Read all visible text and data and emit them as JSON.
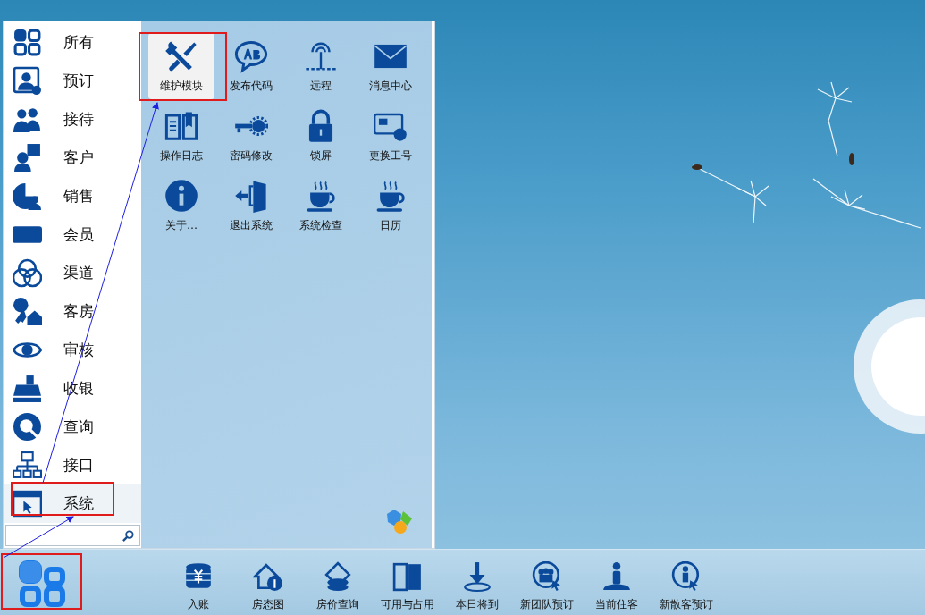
{
  "start_menu": {
    "categories": [
      {
        "label": "所有",
        "selected": false
      },
      {
        "label": "预订",
        "selected": false
      },
      {
        "label": "接待",
        "selected": false
      },
      {
        "label": "客户",
        "selected": false
      },
      {
        "label": "销售",
        "selected": false
      },
      {
        "label": "会员",
        "selected": false
      },
      {
        "label": "渠道",
        "selected": false
      },
      {
        "label": "客房",
        "selected": false
      },
      {
        "label": "审核",
        "selected": false
      },
      {
        "label": "收银",
        "selected": false
      },
      {
        "label": "查询",
        "selected": false
      },
      {
        "label": "接口",
        "selected": false
      },
      {
        "label": "系统",
        "selected": true
      }
    ],
    "apps": [
      {
        "label": "维护模块",
        "selected": true
      },
      {
        "label": "发布代码",
        "selected": false
      },
      {
        "label": "远程",
        "selected": false
      },
      {
        "label": "消息中心",
        "selected": false
      },
      {
        "label": "操作日志",
        "selected": false
      },
      {
        "label": "密码修改",
        "selected": false
      },
      {
        "label": "锁屏",
        "selected": false
      },
      {
        "label": "更换工号",
        "selected": false
      },
      {
        "label": "关于…",
        "selected": false
      },
      {
        "label": "退出系统",
        "selected": false
      },
      {
        "label": "系统检查",
        "selected": false
      },
      {
        "label": "日历",
        "selected": false
      }
    ]
  },
  "taskbar": {
    "items": [
      {
        "label": "入账"
      },
      {
        "label": "房态图"
      },
      {
        "label": "房价查询"
      },
      {
        "label": "可用与占用"
      },
      {
        "label": "本日将到"
      },
      {
        "label": "新团队预订"
      },
      {
        "label": "当前住客"
      },
      {
        "label": "新散客预订"
      }
    ]
  }
}
